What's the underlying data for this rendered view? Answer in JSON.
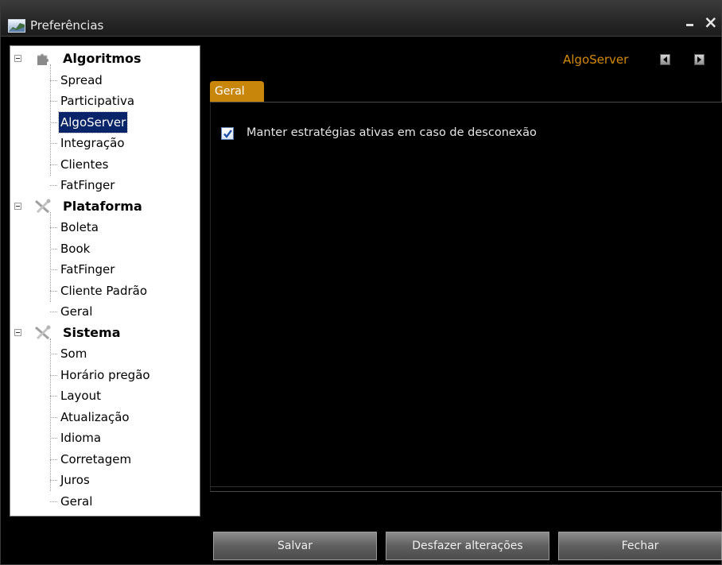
{
  "window": {
    "title": "Preferências",
    "icon": "chart-icon"
  },
  "tree": {
    "categories": [
      {
        "label": "Algoritmos",
        "icon": "puzzle-icon",
        "items": [
          "Spread",
          "Participativa",
          "AlgoServer",
          "Integração",
          "Clientes",
          "FatFinger"
        ]
      },
      {
        "label": "Plataforma",
        "icon": "tools-icon",
        "items": [
          "Boleta",
          "Book",
          "FatFinger",
          "Cliente Padrão",
          "Geral"
        ]
      },
      {
        "label": "Sistema",
        "icon": "tools-icon",
        "items": [
          "Som",
          "Horário pregão",
          "Layout",
          "Atualização",
          "Idioma",
          "Corretagem",
          "Juros",
          "Geral"
        ]
      }
    ],
    "selected": "AlgoServer"
  },
  "header": {
    "section_label": "AlgoServer",
    "prev_icon": "arrow-left-icon",
    "next_icon": "arrow-right-icon"
  },
  "tabs": [
    {
      "label": "Geral"
    }
  ],
  "options": {
    "keep_strategies_label": "Manter estratégias ativas em caso de desconexão",
    "keep_strategies_checked": true
  },
  "buttons": {
    "save": "Salvar",
    "undo": "Desfazer alterações",
    "close": "Fechar"
  },
  "colors": {
    "accent": "#d28a00",
    "tab": "#c8860a",
    "selection": "#0a246a"
  }
}
